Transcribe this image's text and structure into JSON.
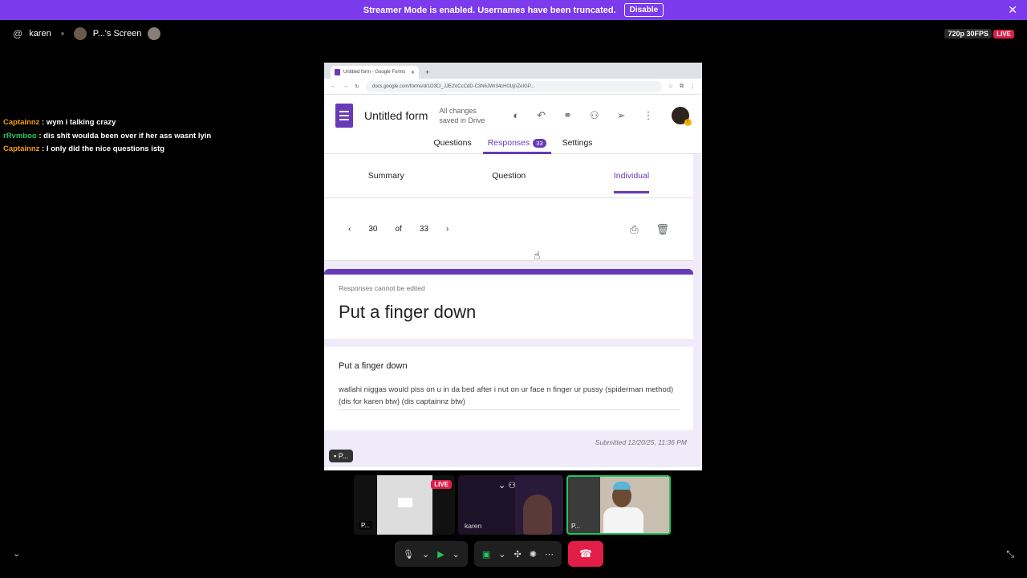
{
  "banner": {
    "text": "Streamer Mode is enabled. Usernames have been truncated.",
    "button": "Disable",
    "close": "✕"
  },
  "topbar": {
    "user": "karen",
    "screen_label": "P...'s Screen",
    "quality": "720p 30FPS",
    "live": "LIVE"
  },
  "chat": [
    {
      "name": "Captainnz",
      "text": ": wym i talking crazy"
    },
    {
      "name": "rRvmboo",
      "text": ": dis shit woulda been over if her ass wasnt lyin"
    },
    {
      "name": "Captainnz",
      "text": ": I only did the nice questions istg"
    }
  ],
  "browser": {
    "tab_title": "Untitled form - Google Forms",
    "url": "docs.google.com/forms/d/1O3Cl_JJE2VCcCdD-C3N6JWr34cH01tjnZeIGP..."
  },
  "form": {
    "title": "Untitled form",
    "saved": "All changes saved in Drive",
    "tabs": {
      "questions": "Questions",
      "responses": "Responses",
      "responses_count": "33",
      "settings": "Settings"
    },
    "subtabs": {
      "summary": "Summary",
      "question": "Question",
      "individual": "Individual"
    },
    "pager": {
      "current": "30",
      "of": "of",
      "total": "33"
    },
    "note": "Responses cannot be edited",
    "heading": "Put a finger down",
    "question": "Put a finger down",
    "answer": "wallahi niggas would piss on u in da bed after i nut on ur face n finger ur pussy (spiderman method) (dis for karen btw) (dis captainnz btw)",
    "submitted": "Submitted 12/20/25, 11:36 PM"
  },
  "share_chip": "P...",
  "tiles": {
    "screen_tag": "P...",
    "live": "LIVE",
    "karen": "karen",
    "self_tag": "P..."
  }
}
